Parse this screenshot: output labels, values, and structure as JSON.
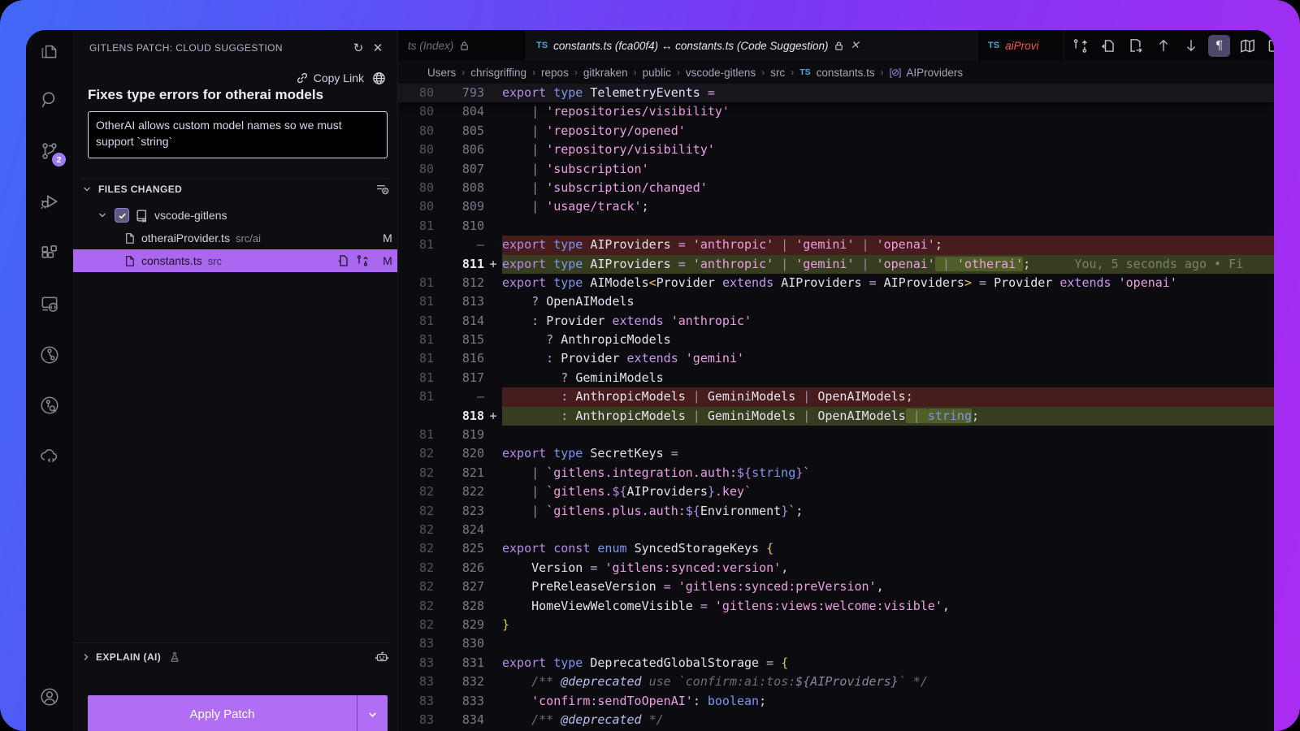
{
  "panel": {
    "header": "GITLENS PATCH: CLOUD SUGGESTION",
    "copy_link": "Copy Link",
    "title": "Fixes type errors for otherai models",
    "description": "OtherAI allows custom model names so we must support `string`",
    "files_changed": {
      "label": "FILES CHANGED",
      "repo": {
        "name": "vscode-gitlens"
      },
      "files": [
        {
          "name": "otheraiProvider.ts",
          "path": "src/ai",
          "status": "M"
        },
        {
          "name": "constants.ts",
          "path": "src",
          "status": "M"
        }
      ]
    },
    "explain_label": "EXPLAIN (AI)",
    "apply_label": "Apply Patch"
  },
  "activity_bar": {
    "scm_badge": "2"
  },
  "tabs": [
    {
      "label": "ts (Index)"
    },
    {
      "label": "constants.ts (fca00f4) ↔ constants.ts (Code Suggestion)",
      "ts_badge": "TS"
    },
    {
      "label": "aiProvi",
      "ts_badge": "TS"
    }
  ],
  "toolbar": {
    "pilcrow": "¶"
  },
  "breadcrumb": {
    "separator": "›",
    "items": [
      {
        "label": "Users"
      },
      {
        "label": "chrisgriffing"
      },
      {
        "label": "repos"
      },
      {
        "label": "gitkraken"
      },
      {
        "label": "public"
      },
      {
        "label": "vscode-gitlens"
      },
      {
        "label": "src"
      },
      {
        "label": "constants.ts",
        "icon": "ts",
        "icon_text": "TS"
      },
      {
        "label": "AIProviders",
        "icon": "symbol",
        "icon_text": "[⊘]"
      }
    ]
  },
  "editor": {
    "lines": [
      {
        "l": "80",
        "r": "793",
        "type": "sticky",
        "seg": [
          {
            "c": "k",
            "t": "export "
          },
          {
            "c": "t",
            "t": "type "
          },
          {
            "c": "i",
            "t": "TelemetryEvents "
          },
          {
            "c": "o",
            "t": "="
          }
        ]
      },
      {
        "l": "80",
        "r": "804",
        "seg": [
          {
            "c": "i",
            "t": "    "
          },
          {
            "c": "p",
            "t": "| "
          },
          {
            "c": "s",
            "t": "'repositories/visibility'"
          }
        ]
      },
      {
        "l": "80",
        "r": "805",
        "seg": [
          {
            "c": "i",
            "t": "    "
          },
          {
            "c": "p",
            "t": "| "
          },
          {
            "c": "s",
            "t": "'repository/opened'"
          }
        ]
      },
      {
        "l": "80",
        "r": "806",
        "seg": [
          {
            "c": "i",
            "t": "    "
          },
          {
            "c": "p",
            "t": "| "
          },
          {
            "c": "s",
            "t": "'repository/visibility'"
          }
        ]
      },
      {
        "l": "80",
        "r": "807",
        "seg": [
          {
            "c": "i",
            "t": "    "
          },
          {
            "c": "p",
            "t": "| "
          },
          {
            "c": "s",
            "t": "'subscription'"
          }
        ]
      },
      {
        "l": "80",
        "r": "808",
        "seg": [
          {
            "c": "i",
            "t": "    "
          },
          {
            "c": "p",
            "t": "| "
          },
          {
            "c": "s",
            "t": "'subscription/changed'"
          }
        ]
      },
      {
        "l": "80",
        "r": "809",
        "seg": [
          {
            "c": "i",
            "t": "    "
          },
          {
            "c": "p",
            "t": "| "
          },
          {
            "c": "s",
            "t": "'usage/track'"
          },
          {
            "c": "w",
            "t": ";"
          }
        ]
      },
      {
        "l": "81",
        "r": "810",
        "seg": []
      },
      {
        "l": "81",
        "m": "—",
        "type": "del",
        "seg": [
          {
            "c": "k",
            "t": "export "
          },
          {
            "c": "t",
            "t": "type "
          },
          {
            "c": "i",
            "t": "AIProviders "
          },
          {
            "c": "o",
            "t": "= "
          },
          {
            "c": "s",
            "t": "'anthropic'"
          },
          {
            "c": "p",
            "t": " | "
          },
          {
            "c": "s",
            "t": "'gemini'"
          },
          {
            "c": "p",
            "t": " | "
          },
          {
            "c": "s",
            "t": "'openai'"
          },
          {
            "c": "w",
            "t": ";"
          }
        ]
      },
      {
        "r": "811",
        "m": "+",
        "type": "add",
        "seg": [
          {
            "c": "k",
            "t": "export "
          },
          {
            "c": "t",
            "t": "type "
          },
          {
            "c": "i",
            "t": "AIProviders "
          },
          {
            "c": "o",
            "t": "= "
          },
          {
            "c": "s",
            "t": "'anthropic'"
          },
          {
            "c": "p",
            "t": " | "
          },
          {
            "c": "s",
            "t": "'gemini'"
          },
          {
            "c": "p",
            "t": " | "
          },
          {
            "c": "s",
            "t": "'openai'"
          },
          {
            "c": "p hl",
            "t": " | "
          },
          {
            "c": "s hl",
            "t": "'otherai'"
          },
          {
            "c": "w",
            "t": ";"
          }
        ],
        "blame": "      You, 5 seconds ago • Fi"
      },
      {
        "l": "81",
        "r": "812",
        "seg": [
          {
            "c": "k",
            "t": "export "
          },
          {
            "c": "t",
            "t": "type "
          },
          {
            "c": "i",
            "t": "AIModels"
          },
          {
            "c": "y",
            "t": "<"
          },
          {
            "c": "i",
            "t": "Provider "
          },
          {
            "c": "x",
            "t": "extends "
          },
          {
            "c": "i",
            "t": "AIProviders "
          },
          {
            "c": "o",
            "t": "= "
          },
          {
            "c": "i",
            "t": "AIProviders"
          },
          {
            "c": "y",
            "t": ">"
          },
          {
            "c": "o",
            "t": " = "
          },
          {
            "c": "i",
            "t": "Provider "
          },
          {
            "c": "x",
            "t": "extends "
          },
          {
            "c": "s",
            "t": "'openai'"
          }
        ]
      },
      {
        "l": "81",
        "r": "813",
        "seg": [
          {
            "c": "o",
            "t": "    ? "
          },
          {
            "c": "i",
            "t": "OpenAIModels"
          }
        ]
      },
      {
        "l": "81",
        "r": "814",
        "seg": [
          {
            "c": "o",
            "t": "    : "
          },
          {
            "c": "i",
            "t": "Provider "
          },
          {
            "c": "x",
            "t": "extends "
          },
          {
            "c": "s",
            "t": "'anthropic'"
          }
        ]
      },
      {
        "l": "81",
        "r": "815",
        "seg": [
          {
            "c": "o",
            "t": "      ? "
          },
          {
            "c": "i",
            "t": "AnthropicModels"
          }
        ]
      },
      {
        "l": "81",
        "r": "816",
        "seg": [
          {
            "c": "o",
            "t": "      : "
          },
          {
            "c": "i",
            "t": "Provider "
          },
          {
            "c": "x",
            "t": "extends "
          },
          {
            "c": "s",
            "t": "'gemini'"
          }
        ]
      },
      {
        "l": "81",
        "r": "817",
        "seg": [
          {
            "c": "o",
            "t": "        ? "
          },
          {
            "c": "i",
            "t": "GeminiModels"
          }
        ]
      },
      {
        "l": "81",
        "m": "—",
        "type": "del",
        "seg": [
          {
            "c": "o",
            "t": "        : "
          },
          {
            "c": "i",
            "t": "AnthropicModels"
          },
          {
            "c": "p",
            "t": " | "
          },
          {
            "c": "i",
            "t": "GeminiModels"
          },
          {
            "c": "p",
            "t": " | "
          },
          {
            "c": "i",
            "t": "OpenAIModels"
          },
          {
            "c": "w",
            "t": ";"
          }
        ]
      },
      {
        "r": "818",
        "m": "+",
        "type": "add",
        "seg": [
          {
            "c": "o",
            "t": "        : "
          },
          {
            "c": "i",
            "t": "AnthropicModels"
          },
          {
            "c": "p",
            "t": " | "
          },
          {
            "c": "i",
            "t": "GeminiModels"
          },
          {
            "c": "p",
            "t": " | "
          },
          {
            "c": "i",
            "t": "OpenAIModels"
          },
          {
            "c": "p hl",
            "t": " | "
          },
          {
            "c": "t hl",
            "t": "string"
          },
          {
            "c": "w",
            "t": ";"
          }
        ]
      },
      {
        "l": "81",
        "r": "819",
        "seg": []
      },
      {
        "l": "82",
        "r": "820",
        "seg": [
          {
            "c": "k",
            "t": "export "
          },
          {
            "c": "t",
            "t": "type "
          },
          {
            "c": "i",
            "t": "SecretKeys "
          },
          {
            "c": "o",
            "t": "="
          }
        ]
      },
      {
        "l": "82",
        "r": "821",
        "seg": [
          {
            "c": "i",
            "t": "    "
          },
          {
            "c": "p",
            "t": "| "
          },
          {
            "c": "s",
            "t": "`gitlens.integration.auth:"
          },
          {
            "c": "b",
            "t": "${"
          },
          {
            "c": "t",
            "t": "string"
          },
          {
            "c": "b",
            "t": "}"
          },
          {
            "c": "s",
            "t": "`"
          }
        ]
      },
      {
        "l": "82",
        "r": "822",
        "seg": [
          {
            "c": "i",
            "t": "    "
          },
          {
            "c": "p",
            "t": "| "
          },
          {
            "c": "s",
            "t": "`gitlens."
          },
          {
            "c": "b",
            "t": "${"
          },
          {
            "c": "i",
            "t": "AIProviders"
          },
          {
            "c": "b",
            "t": "}"
          },
          {
            "c": "s",
            "t": ".key`"
          }
        ]
      },
      {
        "l": "82",
        "r": "823",
        "seg": [
          {
            "c": "i",
            "t": "    "
          },
          {
            "c": "p",
            "t": "| "
          },
          {
            "c": "s",
            "t": "`gitlens.plus.auth:"
          },
          {
            "c": "b",
            "t": "${"
          },
          {
            "c": "i",
            "t": "Environment"
          },
          {
            "c": "b",
            "t": "}"
          },
          {
            "c": "s",
            "t": "`"
          },
          {
            "c": "w",
            "t": ";"
          }
        ]
      },
      {
        "l": "82",
        "r": "824",
        "seg": []
      },
      {
        "l": "82",
        "r": "825",
        "seg": [
          {
            "c": "k",
            "t": "export "
          },
          {
            "c": "k",
            "t": "const "
          },
          {
            "c": "t",
            "t": "enum "
          },
          {
            "c": "i",
            "t": "SyncedStorageKeys "
          },
          {
            "c": "y",
            "t": "{"
          }
        ]
      },
      {
        "l": "82",
        "r": "826",
        "seg": [
          {
            "c": "i",
            "t": "    Version "
          },
          {
            "c": "o",
            "t": "= "
          },
          {
            "c": "s",
            "t": "'gitlens:synced:version'"
          },
          {
            "c": "w",
            "t": ","
          }
        ]
      },
      {
        "l": "82",
        "r": "827",
        "seg": [
          {
            "c": "i",
            "t": "    PreReleaseVersion "
          },
          {
            "c": "o",
            "t": "= "
          },
          {
            "c": "s",
            "t": "'gitlens:synced:preVersion'"
          },
          {
            "c": "w",
            "t": ","
          }
        ]
      },
      {
        "l": "82",
        "r": "828",
        "seg": [
          {
            "c": "i",
            "t": "    HomeViewWelcomeVisible "
          },
          {
            "c": "o",
            "t": "= "
          },
          {
            "c": "s",
            "t": "'gitlens:views:welcome:visible'"
          },
          {
            "c": "w",
            "t": ","
          }
        ]
      },
      {
        "l": "82",
        "r": "829",
        "seg": [
          {
            "c": "y",
            "t": "}"
          }
        ]
      },
      {
        "l": "83",
        "r": "830",
        "seg": []
      },
      {
        "l": "83",
        "r": "831",
        "seg": [
          {
            "c": "k",
            "t": "export "
          },
          {
            "c": "t",
            "t": "type "
          },
          {
            "c": "i",
            "t": "DeprecatedGlobalStorage "
          },
          {
            "c": "o",
            "t": "= "
          },
          {
            "c": "y",
            "t": "{"
          }
        ]
      },
      {
        "l": "83",
        "r": "832",
        "seg": [
          {
            "c": "c",
            "t": "    /** "
          },
          {
            "c": "d",
            "t": "@deprecated"
          },
          {
            "c": "c",
            "t": " use `confirm:ai:tos:"
          },
          {
            "c": "cb",
            "t": "${AIProviders}"
          },
          {
            "c": "c",
            "t": "` */"
          }
        ]
      },
      {
        "l": "83",
        "r": "833",
        "seg": [
          {
            "c": "s",
            "t": "    'confirm:sendToOpenAI'"
          },
          {
            "c": "w",
            "t": ": "
          },
          {
            "c": "t",
            "t": "boolean"
          },
          {
            "c": "w",
            "t": ";"
          }
        ]
      },
      {
        "l": "83",
        "r": "834",
        "seg": [
          {
            "c": "c",
            "t": "    /** "
          },
          {
            "c": "d",
            "t": "@deprecated"
          },
          {
            "c": "c",
            "t": " */"
          }
        ]
      }
    ]
  }
}
